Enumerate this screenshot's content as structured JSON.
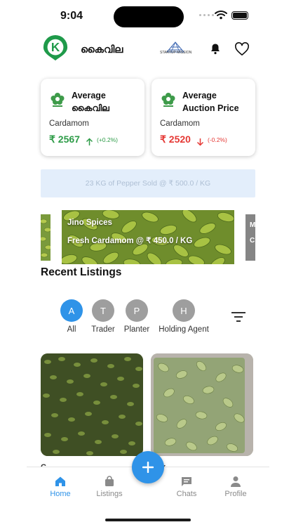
{
  "status_bar": {
    "time": "9:04"
  },
  "header": {
    "logo_letter": "K",
    "app_title": "കൈവില",
    "partner_logo_text": "STARTUP MISSION",
    "partner_logo_icon": "ksum-logo",
    "notifications_icon": "bell-icon",
    "favorites_icon": "heart-icon"
  },
  "price_cards": [
    {
      "title_line1": "Average",
      "title_line2": "കൈവില",
      "crop": "Cardamom",
      "price": "₹ 2567",
      "change": "(+0.2%)",
      "trend": "up",
      "icon": "flower-icon"
    },
    {
      "title_line1": "Average",
      "title_line2": "Auction Price",
      "crop": "Cardamom",
      "price": "₹ 2520",
      "change": "(-0.2%)",
      "trend": "down",
      "icon": "flower-icon"
    }
  ],
  "marquee": {
    "text": "23 KG of Pepper Sold @ ₹ 500.0 / KG"
  },
  "carousel": {
    "current": {
      "seller": "Jino Spices",
      "offer": "Fresh Cardamom @ ₹ 450.0 / KG"
    },
    "next_peek": {
      "line1": "M",
      "line2": "C"
    }
  },
  "listings": {
    "title": "Recent Listings",
    "filters": [
      {
        "letter": "A",
        "label": "All",
        "active": true
      },
      {
        "letter": "T",
        "label": "Trader",
        "active": false
      },
      {
        "letter": "P",
        "label": "Planter",
        "active": false
      },
      {
        "letter": "H",
        "label": "Holding Agent",
        "active": false
      }
    ],
    "sort_icon": "filter-sort-icon",
    "partial_text_left": "C",
    "partial_text_right": "k"
  },
  "bottom_nav": {
    "items": [
      {
        "label": "Home",
        "icon": "home-icon",
        "active": true
      },
      {
        "label": "Listings",
        "icon": "shopping-bag-icon",
        "active": false
      },
      {
        "label": "Chats",
        "icon": "chat-icon",
        "active": false
      },
      {
        "label": "Profile",
        "icon": "person-icon",
        "active": false
      }
    ],
    "fab_icon": "plus-icon"
  },
  "colors": {
    "accent": "#2f93e8",
    "up": "#2e9c48",
    "down": "#e53935",
    "brand": "#1f9a4a"
  }
}
